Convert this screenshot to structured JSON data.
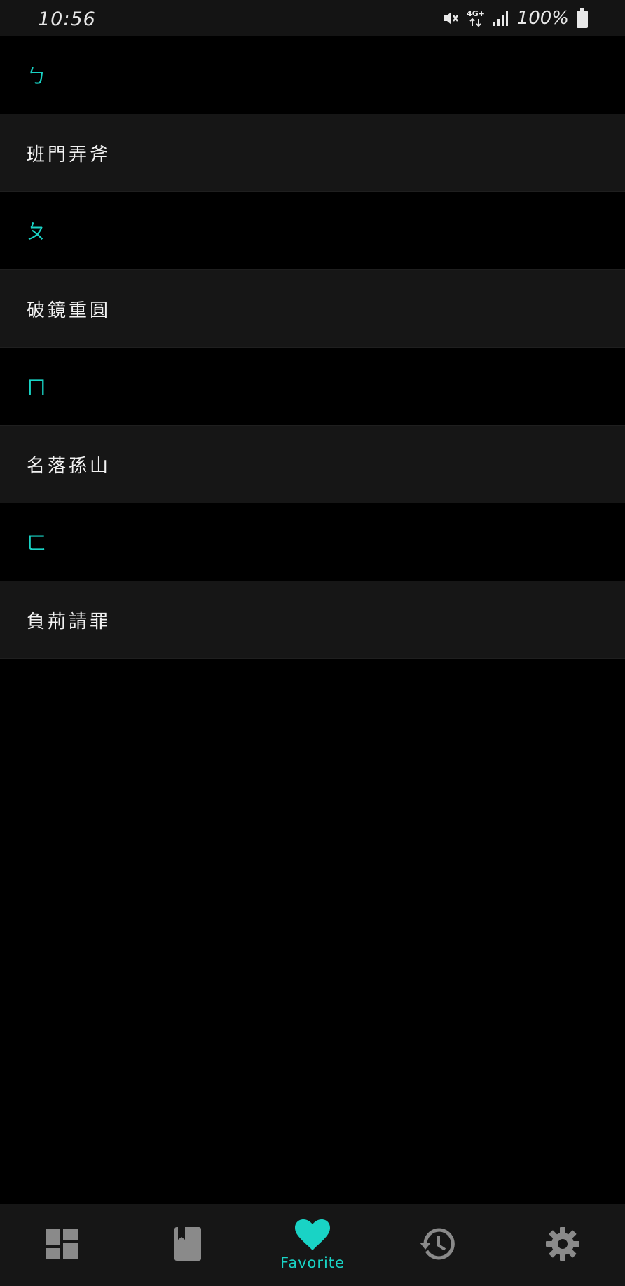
{
  "status_bar": {
    "time": "10:56",
    "network": "4G+",
    "battery": "100%"
  },
  "favorites": {
    "sections": [
      {
        "header": "ㄅ",
        "items": [
          "班門弄斧"
        ]
      },
      {
        "header": "ㄆ",
        "items": [
          "破鏡重圓"
        ]
      },
      {
        "header": "ㄇ",
        "items": [
          "名落孫山"
        ]
      },
      {
        "header": "ㄈ",
        "items": [
          "負荊請罪"
        ]
      }
    ]
  },
  "bottom_nav": {
    "items": [
      {
        "icon": "dashboard-icon",
        "label": "",
        "active": false
      },
      {
        "icon": "book-icon",
        "label": "",
        "active": false
      },
      {
        "icon": "heart-icon",
        "label": "Favorite",
        "active": true
      },
      {
        "icon": "history-icon",
        "label": "",
        "active": false
      },
      {
        "icon": "gear-icon",
        "label": "",
        "active": false
      }
    ]
  },
  "colors": {
    "accent": "#19d3c5",
    "background": "#000000",
    "row_background": "#161616",
    "inactive_icon": "#8a8a8a"
  }
}
